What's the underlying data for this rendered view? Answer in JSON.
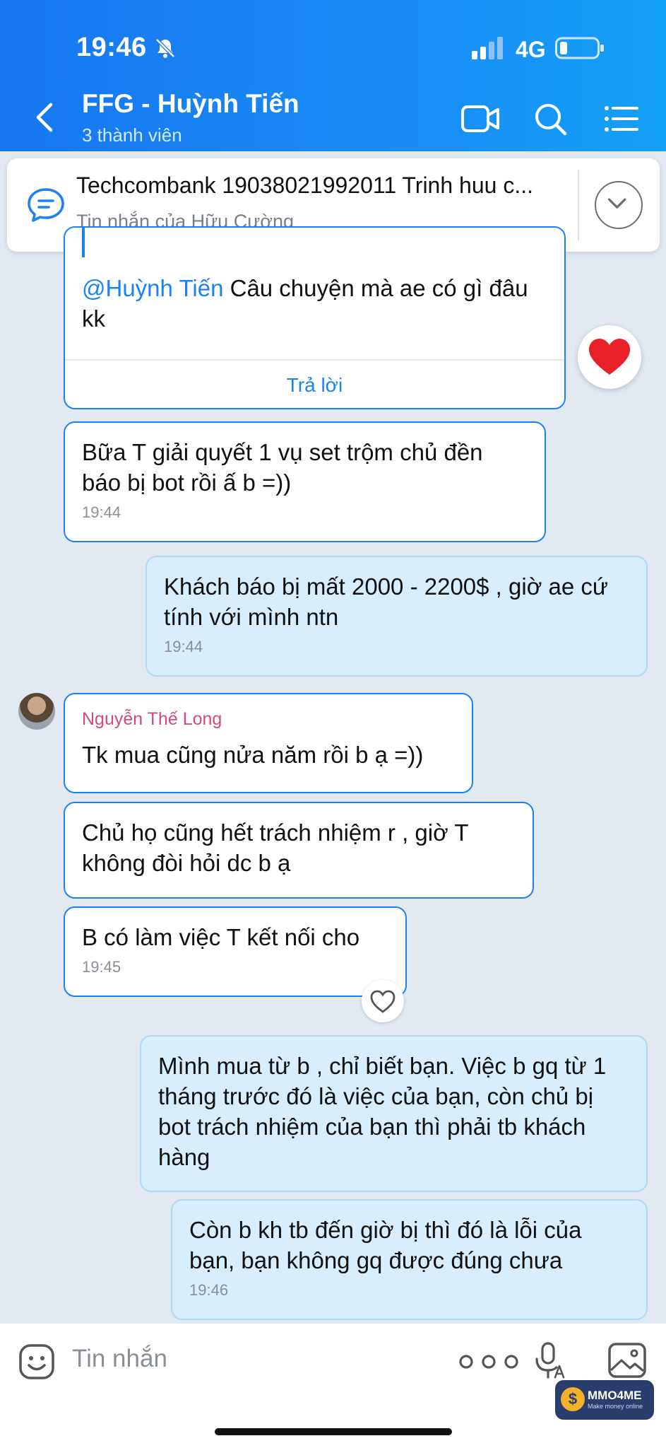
{
  "status_bar": {
    "time": "19:46",
    "network": "4G"
  },
  "header": {
    "title": "FFG - Huỳnh Tiến",
    "subtitle": "3 thành viên"
  },
  "pinned": {
    "title": "Techcombank 19038021992011 Trinh huu c...",
    "subtitle": "Tin nhắn của Hữu Cường"
  },
  "quote_message": {
    "mention": "@Huỳnh Tiến",
    "text": " Câu chuyện mà ae có gì đâu kk",
    "reply_label": "Trả lời"
  },
  "messages": [
    {
      "id": "m1",
      "text": "Bữa T giải quyết 1 vụ set trộm chủ đền báo bị bot rồi ấ b =))",
      "time": "19:44"
    },
    {
      "id": "m2",
      "text": "Khách báo bị mất 2000 - 2200$ , giờ ae cứ tính với mình ntn",
      "time": "19:44"
    },
    {
      "id": "m3",
      "sender": "Nguyễn Thế Long",
      "text": "Tk mua cũng nửa năm rồi b ạ =))"
    },
    {
      "id": "m4",
      "text": "Chủ họ cũng hết trách nhiệm r , giờ T không đòi hỏi dc b ạ"
    },
    {
      "id": "m5",
      "text": "B có làm việc T kết nối cho",
      "time": "19:45"
    },
    {
      "id": "m6",
      "text": "Mình mua từ b , chỉ biết bạn. Việc b gq từ 1 tháng trước đó là việc của bạn, còn chủ bị bot trách nhiệm của bạn thì phải tb khách hàng"
    },
    {
      "id": "m7",
      "text": "Còn b kh tb đến giờ bị thì đó là lỗi của bạn, bạn không gq được đúng chưa",
      "time": "19:46"
    }
  ],
  "input": {
    "placeholder": "Tin nhắn"
  },
  "watermark": {
    "text": "MMO4ME",
    "sub": "Make money online"
  },
  "colors": {
    "header": "#1677f0",
    "accent": "#1a82f5",
    "mine_bubble": "#d6eefd",
    "sender_name": "#d24a7a"
  }
}
